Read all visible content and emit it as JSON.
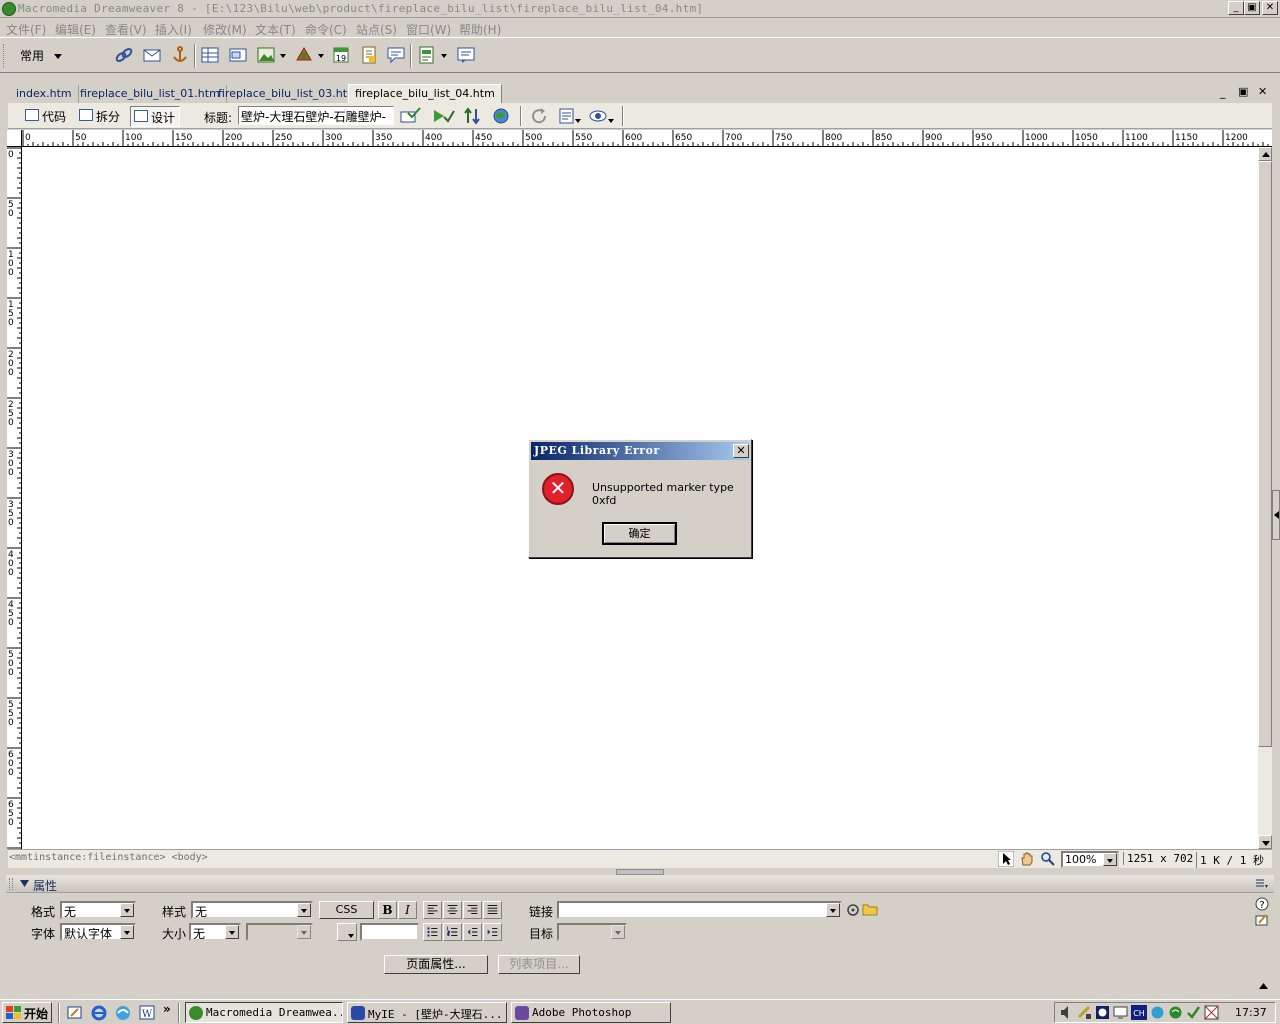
{
  "window": {
    "title": "Macromedia Dreamweaver 8 - [E:\\123\\Bilu\\web\\product\\fireplace_bilu_list\\fireplace_bilu_list_04.htm]",
    "min": "_",
    "max": "▣",
    "close": "✕"
  },
  "menu": [
    "文件(F)",
    "编辑(E)",
    "查看(V)",
    "插入(I)",
    "修改(M)",
    "文本(T)",
    "命令(C)",
    "站点(S)",
    "窗口(W)",
    "帮助(H)"
  ],
  "insertbar": {
    "category": "常用"
  },
  "doc_tabs": [
    "index.htm",
    "fireplace_bilu_list_01.htm",
    "fireplace_bilu_list_03.htm",
    "fireplace_bilu_list_04.htm"
  ],
  "doc_window_controls": {
    "min": "_",
    "restore": "▣",
    "close": "✕"
  },
  "doc_toolbar": {
    "code": "代码",
    "split": "拆分",
    "design": "设计",
    "title_label": "标题:",
    "title_value": "壁炉-大理石壁炉-石雕壁炉-"
  },
  "ruler_h": [
    "0",
    "50",
    "100",
    "150",
    "200",
    "250",
    "300",
    "350",
    "400",
    "450",
    "500",
    "550",
    "600",
    "650",
    "700",
    "750",
    "800",
    "850",
    "900",
    "950",
    "1000",
    "1050",
    "1100",
    "1150",
    "1200"
  ],
  "ruler_v": [
    "0",
    "50",
    "100",
    "150",
    "200",
    "250",
    "300",
    "350",
    "400",
    "450",
    "500",
    "550",
    "600",
    "650"
  ],
  "statusbar": {
    "tags": "<mmtinstance:fileinstance> <body>",
    "zoom": "100%",
    "size": "1251 x 702",
    "download": "1 K / 1 秒"
  },
  "properties": {
    "title": "属性",
    "format_label": "格式",
    "format_value": "无",
    "style_label": "样式",
    "style_value": "无",
    "css": "CSS",
    "bold": "B",
    "italic": "I",
    "link_label": "链接",
    "link_value": "",
    "font_label": "字体",
    "font_value": "默认字体",
    "size_label": "大小",
    "size_value": "无",
    "target_label": "目标",
    "page_props": "页面属性...",
    "list_item": "列表项目..."
  },
  "dialog": {
    "title": "JPEG Library Error",
    "message": "Unsupported marker type 0xfd",
    "ok": "确定",
    "close": "✕"
  },
  "taskbar": {
    "start": "开始",
    "tasks": [
      {
        "label": "Macromedia Dreamwea...",
        "color": "#3a8a2a"
      },
      {
        "label": "MyIE - [壁炉-大理石...",
        "color": "#2a4aa8"
      },
      {
        "label": "Adobe Photoshop",
        "color": "#6a4aa0"
      }
    ],
    "clock": "17:37"
  }
}
